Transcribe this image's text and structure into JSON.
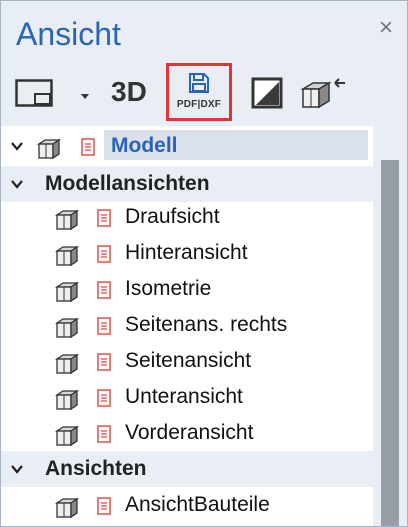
{
  "panel": {
    "title": "Ansicht",
    "close_icon": "close-icon"
  },
  "toolbar": {
    "view_frame_icon": "view-frame-icon",
    "dropdown_icon": "chevron-down-icon",
    "btn_3d_label": "3D",
    "export_pdf_dxf_label": "PDF|DXF",
    "section_view_icon": "section-view-icon",
    "export_view_icon": "export-view-icon",
    "highlight_color": "#e5333a"
  },
  "tree": {
    "root": {
      "label": "Modell"
    },
    "group1": {
      "label": "Modellansichten",
      "items": [
        "Draufsicht",
        "Hinteransicht",
        "Isometrie",
        "Seitenans. rechts",
        "Seitenansicht",
        "Unteransicht",
        "Vorderansicht"
      ]
    },
    "group2": {
      "label": "Ansichten",
      "items": [
        "AnsichtBauteile"
      ]
    }
  },
  "colors": {
    "accent": "#2a64b6",
    "doc_icon": "#d9534f",
    "panel_bg": "#e9eef5"
  }
}
